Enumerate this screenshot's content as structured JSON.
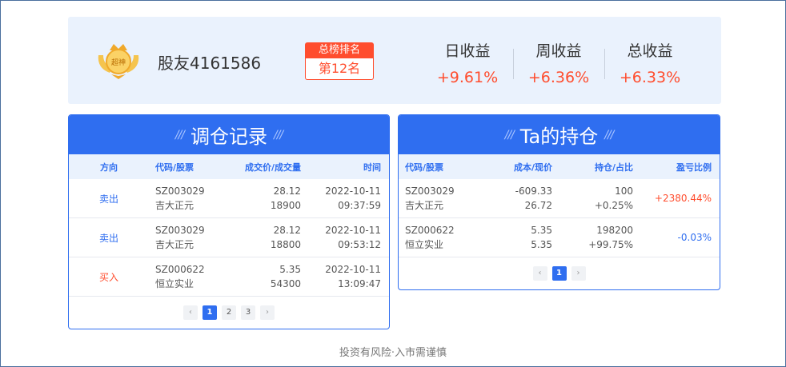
{
  "user": {
    "name": "股友4161586",
    "badge_text": "超神"
  },
  "rank": {
    "label": "总榜排名",
    "value": "第12名"
  },
  "stats": [
    {
      "label": "日收益",
      "value": "+9.61%"
    },
    {
      "label": "周收益",
      "value": "+6.36%"
    },
    {
      "label": "总收益",
      "value": "+6.33%"
    }
  ],
  "trades": {
    "title": "调仓记录",
    "columns": [
      "方向",
      "代码/股票",
      "成交价/成交量",
      "时间"
    ],
    "rows": [
      {
        "direction": "卖出",
        "code": "SZ003029",
        "name": "吉大正元",
        "price": "28.12",
        "volume": "18900",
        "date": "2022-10-11",
        "time": "09:37:59"
      },
      {
        "direction": "卖出",
        "code": "SZ003029",
        "name": "吉大正元",
        "price": "28.12",
        "volume": "18800",
        "date": "2022-10-11",
        "time": "09:53:12"
      },
      {
        "direction": "买入",
        "code": "SZ000622",
        "name": "恒立实业",
        "price": "5.35",
        "volume": "54300",
        "date": "2022-10-11",
        "time": "13:09:47"
      }
    ],
    "pager": {
      "prev": "‹",
      "pages": [
        "1",
        "2",
        "3"
      ],
      "next": "›"
    }
  },
  "holdings": {
    "title": "Ta的持仓",
    "columns": [
      "代码/股票",
      "成本/现价",
      "持仓/占比",
      "盈亏比例"
    ],
    "rows": [
      {
        "code": "SZ003029",
        "name": "吉大正元",
        "cost": "-609.33",
        "current": "26.72",
        "position": "100",
        "ratio": "+0.25%",
        "pl": "+2380.44%"
      },
      {
        "code": "SZ000622",
        "name": "恒立实业",
        "cost": "5.35",
        "current": "5.35",
        "position": "198200",
        "ratio": "+99.75%",
        "pl": "-0.03%"
      }
    ],
    "pager": {
      "prev": "‹",
      "pages": [
        "1"
      ],
      "next": "›"
    }
  },
  "footer": "投资有风险·入市需谨慎",
  "colors": {
    "accent": "#2f6ef0",
    "up": "#ff4d2e",
    "header_bg": "#eaf2fd"
  }
}
